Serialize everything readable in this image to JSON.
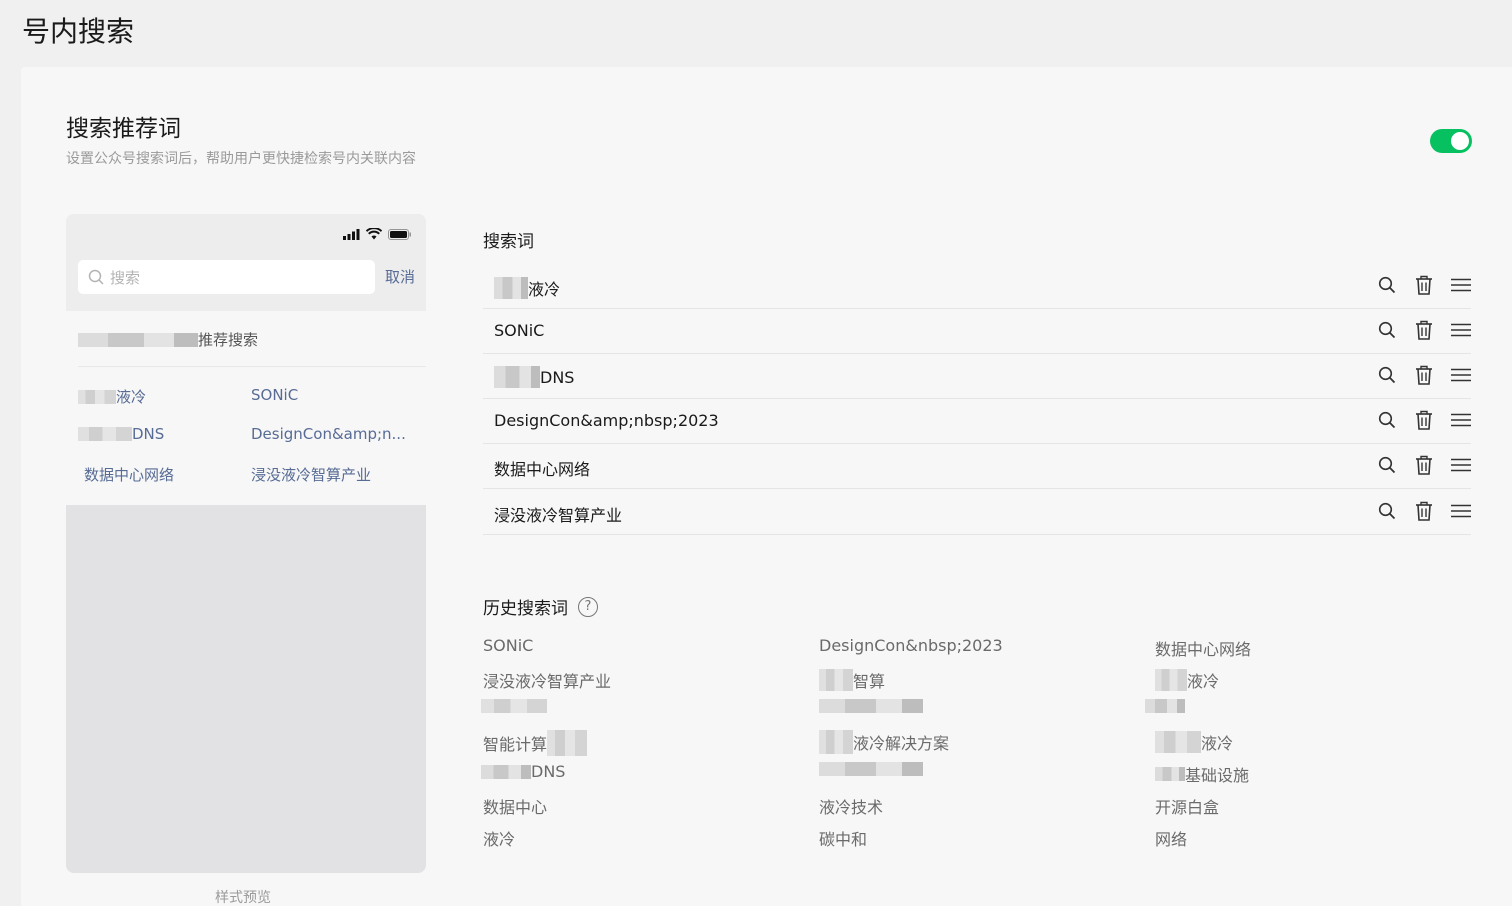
{
  "page": {
    "title": "号内搜索"
  },
  "section": {
    "title": "搜索推荐词",
    "description": "设置公众号搜索词后，帮助用户更快捷检索号内关联内容",
    "toggle_on": true
  },
  "preview": {
    "search_placeholder": "搜索",
    "cancel_label": "取消",
    "recommend_suffix": "推荐搜索",
    "items": [
      {
        "text": "液冷"
      },
      {
        "text": "SONiC"
      },
      {
        "text": "DNS"
      },
      {
        "text": "DesignCon&amp;n..."
      },
      {
        "text": "数据中心网络"
      },
      {
        "text": "浸没液冷智算产业"
      }
    ],
    "label": "样式预览"
  },
  "keywords": {
    "title": "搜索词",
    "rows": [
      {
        "text": "液冷"
      },
      {
        "text": "SONiC"
      },
      {
        "text": "DNS"
      },
      {
        "text": "DesignCon&amp;nbsp;2023"
      },
      {
        "text": "数据中心网络"
      },
      {
        "text": "浸没液冷智算产业"
      }
    ]
  },
  "history": {
    "title": "历史搜索词",
    "help_icon": "?",
    "columns": [
      [
        "SONiC",
        "浸没液冷智算产业",
        "",
        "智能计算",
        "DNS",
        "数据中心",
        "液冷"
      ],
      [
        "DesignCon&nbsp;2023",
        "智算",
        "",
        "液冷解决方案",
        "",
        "液冷技术",
        "碳中和"
      ],
      [
        "数据中心网络",
        "液冷",
        "",
        "液冷",
        "基础设施",
        "开源白盒",
        "网络"
      ]
    ]
  },
  "colors": {
    "accent": "#07c160",
    "link": "#576b95"
  },
  "icons": [
    "signal-icon",
    "wifi-icon",
    "battery-icon",
    "search-icon",
    "trash-icon",
    "drag-handle-icon",
    "help-icon"
  ]
}
